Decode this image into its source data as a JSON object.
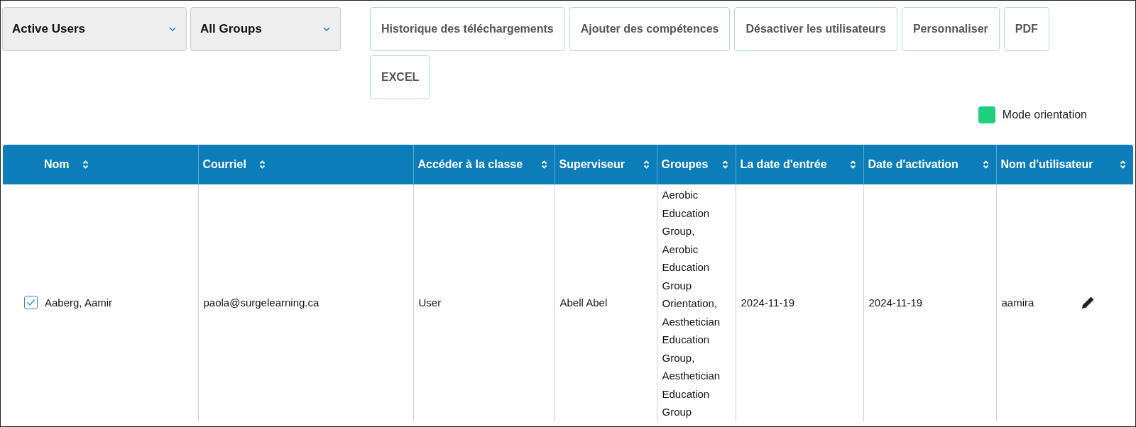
{
  "filters": [
    {
      "label": "Active Users"
    },
    {
      "label": "All Groups"
    }
  ],
  "buttons": [
    "Historique des téléchargements",
    "Ajouter des compétences",
    "Désactiver les utilisateurs",
    "Personnaliser",
    "PDF",
    "EXCEL"
  ],
  "legend": {
    "label": "Mode orientation",
    "color": "#1ecf7e"
  },
  "table": {
    "columns": [
      "Nom",
      "Courriel",
      "Accéder à la classe",
      "Superviseur",
      "Groupes",
      "La date d'entrée",
      "Date d'activation",
      "Nom d'utilisateur"
    ],
    "rows": [
      {
        "checked": true,
        "cells": [
          "Aaberg, Aamir",
          "paola@surgelearning.ca",
          "User",
          "Abell Abel",
          "Aerobic Education Group, Aerobic Education Group Orientation, Aesthetician Education Group, Aesthetician Education Group",
          "2024-11-19",
          "2024-11-19",
          "aamira"
        ]
      }
    ]
  }
}
